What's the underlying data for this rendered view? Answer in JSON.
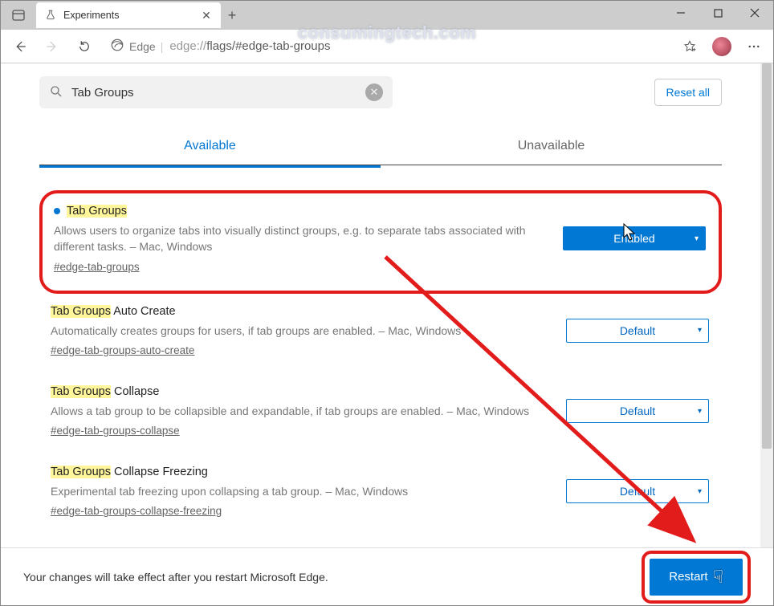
{
  "window": {
    "tab_title": "Experiments",
    "edge_label": "Edge",
    "url_scheme": "edge://",
    "url_path": "flags/#edge-tab-groups"
  },
  "watermark": "consumingtech.com",
  "search": {
    "value": "Tab Groups",
    "reset_label": "Reset all"
  },
  "page_tabs": {
    "available": "Available",
    "unavailable": "Unavailable"
  },
  "flags": [
    {
      "title_hl": "Tab Groups",
      "title_rest": "",
      "desc": "Allows users to organize tabs into visually distinct groups, e.g. to separate tabs associated with different tasks. – Mac, Windows",
      "hash": "#edge-tab-groups",
      "value": "Enabled",
      "solid": true,
      "bullet": true,
      "highlight": true
    },
    {
      "title_hl": "Tab Groups",
      "title_rest": " Auto Create",
      "desc": "Automatically creates groups for users, if tab groups are enabled. – Mac, Windows",
      "hash": "#edge-tab-groups-auto-create",
      "value": "Default",
      "solid": false,
      "bullet": false,
      "highlight": false
    },
    {
      "title_hl": "Tab Groups",
      "title_rest": " Collapse",
      "desc": "Allows a tab group to be collapsible and expandable, if tab groups are enabled. – Mac, Windows",
      "hash": "#edge-tab-groups-collapse",
      "value": "Default",
      "solid": false,
      "bullet": false,
      "highlight": false
    },
    {
      "title_hl": "Tab Groups",
      "title_rest": " Collapse Freezing",
      "desc": "Experimental tab freezing upon collapsing a tab group. – Mac, Windows",
      "hash": "#edge-tab-groups-collapse-freezing",
      "value": "Default",
      "solid": false,
      "bullet": false,
      "highlight": false
    }
  ],
  "footer": {
    "text": "Your changes will take effect after you restart Microsoft Edge.",
    "restart_label": "Restart"
  }
}
